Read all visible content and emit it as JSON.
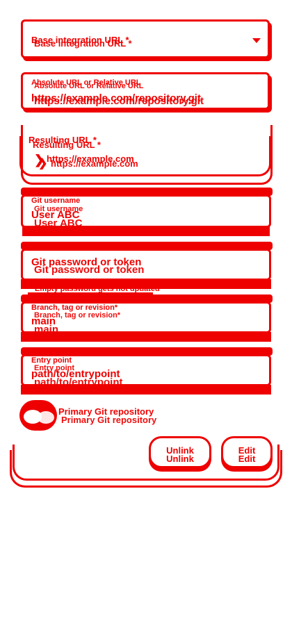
{
  "form": {
    "base_url": {
      "label": "Base integration URL *"
    },
    "relative_url": {
      "label": "Absolute URL or Relative URL",
      "value": "https://example.com/repository.git"
    },
    "resulting_url": {
      "label": "Resulting URL *",
      "value": "https://example.com"
    },
    "git_username": {
      "label": "Git username",
      "value": "User ABC"
    },
    "git_password": {
      "label": "Git password or token",
      "helper": "Empty password gets not updated"
    },
    "branch": {
      "label": "Branch, tag or revision*",
      "value": "main"
    },
    "entry_point": {
      "label": "Entry point",
      "value": "path/to/entrypoint"
    },
    "primary_toggle": {
      "label": "Primary Git repository",
      "checked": true
    }
  },
  "actions": {
    "unlink": "Unlink",
    "edit": "Edit"
  },
  "icons": {
    "dropdown": "chevron-down-icon",
    "expand": "chevron-right-icon"
  },
  "colors": {
    "accent": "#ee0000",
    "background": "#ffffff"
  }
}
